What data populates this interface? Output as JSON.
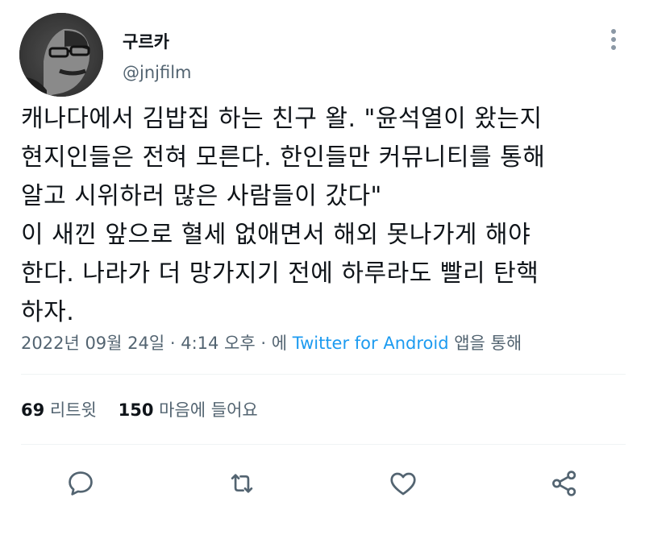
{
  "user": {
    "display_name": "구르카",
    "handle": "@jnjfilm"
  },
  "tweet": {
    "lines": [
      "캐나다에서 김밥집 하는 친구 왈. \"윤석열이 왔는지",
      "현지인들은 전혀 모른다. 한인들만 커뮤니티를 통해",
      "알고 시위하러 많은 사람들이 갔다\"",
      "이 새낀 앞으로 혈세 없애면서 해외 못나가게 해야",
      "한다. 나라가 더 망가지기 전에 하루라도 빨리 탄핵",
      "하자."
    ]
  },
  "meta": {
    "timestamp": "2022년 09월 24일 · 4:14 오후 · 에 ",
    "source": "Twitter for Android",
    "suffix": " 앱을 통해"
  },
  "stats": {
    "retweets_count": "69",
    "retweets_label": "리트윗",
    "likes_count": "150",
    "likes_label": "마음에 들어요"
  },
  "actions": {
    "reply_icon": "comment-icon",
    "retweet_icon": "retweet-icon",
    "like_icon": "heart-icon",
    "share_icon": "share-icon"
  },
  "colors": {
    "text": "#0f1419",
    "muted": "#536471",
    "accent": "#1d9bf0",
    "icon": "#536471"
  }
}
